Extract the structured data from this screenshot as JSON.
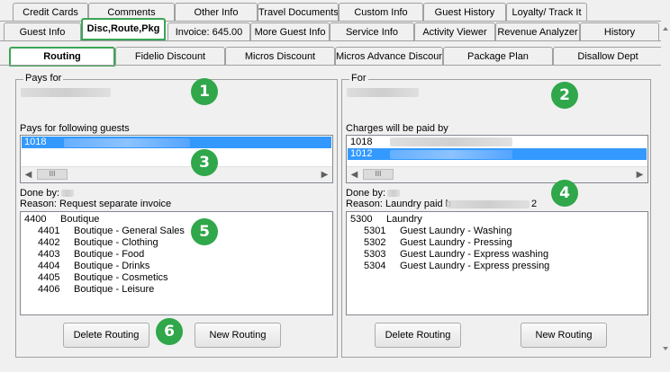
{
  "tabs_row1": [
    "Credit Cards",
    "Comments",
    "Other Info",
    "Travel Documents",
    "Custom Info",
    "Guest History",
    "Loyalty/ Track It"
  ],
  "tabs_row2": [
    "Guest Info",
    "Disc,Route,Pkg",
    "Invoice: 645.00",
    "More Guest Info",
    "Service Info",
    "Activity Viewer",
    "Revenue Analyzer",
    "History"
  ],
  "tabs_row3": [
    "Routing",
    "Fidelio Discount",
    "Micros Discount",
    "Micros Advance Discount",
    "Package Plan",
    "Disallow Dept"
  ],
  "left": {
    "legend": "Pays for",
    "guests_label": "Pays for following guests",
    "guests": [
      {
        "code": "1018",
        "selected": true
      }
    ],
    "done_by": "Done by:",
    "reason": "Reason: Request separate invoice",
    "items": [
      {
        "code": "4400",
        "name": "Boutique",
        "indent": false
      },
      {
        "code": "4401",
        "name": "Boutique - General Sales",
        "indent": true
      },
      {
        "code": "4402",
        "name": "Boutique - Clothing",
        "indent": true
      },
      {
        "code": "4403",
        "name": "Boutique - Food",
        "indent": true
      },
      {
        "code": "4404",
        "name": "Boutique - Drinks",
        "indent": true
      },
      {
        "code": "4405",
        "name": "Boutique - Cosmetics",
        "indent": true
      },
      {
        "code": "4406",
        "name": "Boutique - Leisure",
        "indent": true
      }
    ],
    "delete_label": "Delete Routing",
    "new_label": "New Routing"
  },
  "right": {
    "legend": "For",
    "charges_label": "Charges will be paid by",
    "guests": [
      {
        "code": "1018",
        "selected": false
      },
      {
        "code": "1012",
        "selected": true
      }
    ],
    "done_by": "Done by:",
    "reason_start": "Reason: Laundry paid b",
    "reason_end": "2",
    "items": [
      {
        "code": "5300",
        "name": "Laundry",
        "indent": false
      },
      {
        "code": "5301",
        "name": "Guest Laundry - Washing",
        "indent": true
      },
      {
        "code": "5302",
        "name": "Guest Laundry - Pressing",
        "indent": true
      },
      {
        "code": "5303",
        "name": "Guest Laundry - Express washing",
        "indent": true
      },
      {
        "code": "5304",
        "name": "Guest Laundry - Express pressing",
        "indent": true
      }
    ],
    "delete_label": "Delete Routing",
    "new_label": "New Routing"
  },
  "badges": [
    "1",
    "2",
    "3",
    "4",
    "5",
    "6"
  ],
  "scroll_thumb": "III",
  "colors": {
    "highlight": "#3aa655",
    "selection": "#3399ff",
    "badge": "#2fa74a"
  }
}
